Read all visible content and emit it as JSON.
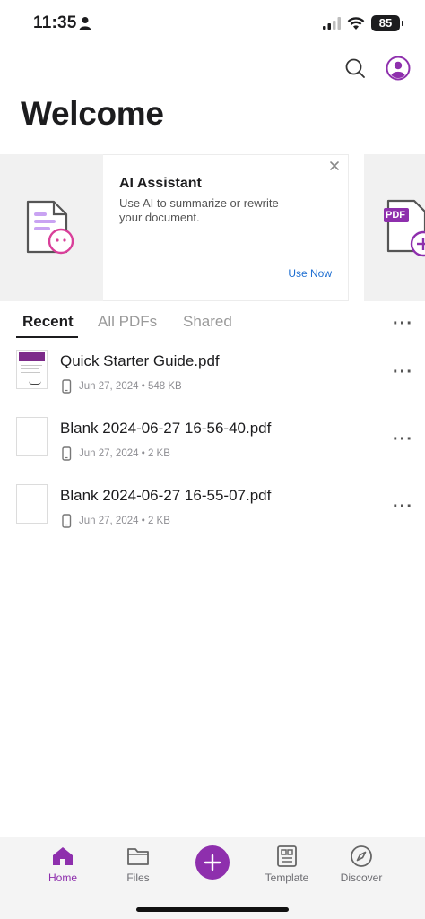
{
  "status": {
    "time": "11:35",
    "battery": "85"
  },
  "page": {
    "title": "Welcome"
  },
  "promo": {
    "title": "AI Assistant",
    "description": "Use AI to summarize or rewrite your document.",
    "cta": "Use Now",
    "next_card_badge": "PDF"
  },
  "tabs": [
    "Recent",
    "All PDFs",
    "Shared"
  ],
  "files": [
    {
      "name": "Quick Starter Guide.pdf",
      "date": "Jun 27, 2024",
      "size": "548 KB"
    },
    {
      "name": "Blank 2024-06-27 16-56-40.pdf",
      "date": "Jun 27, 2024",
      "size": "2 KB"
    },
    {
      "name": "Blank 2024-06-27 16-55-07.pdf",
      "date": "Jun 27, 2024",
      "size": "2 KB"
    }
  ],
  "nav": {
    "home": "Home",
    "files": "Files",
    "template": "Template",
    "discover": "Discover"
  },
  "icons": {
    "search": "search-icon",
    "profile": "profile-icon",
    "close": "close-icon",
    "more": "more-icon",
    "device": "phone-icon",
    "add": "plus-icon"
  },
  "colors": {
    "accent": "#8e2fad",
    "link": "#1f6fd1"
  }
}
